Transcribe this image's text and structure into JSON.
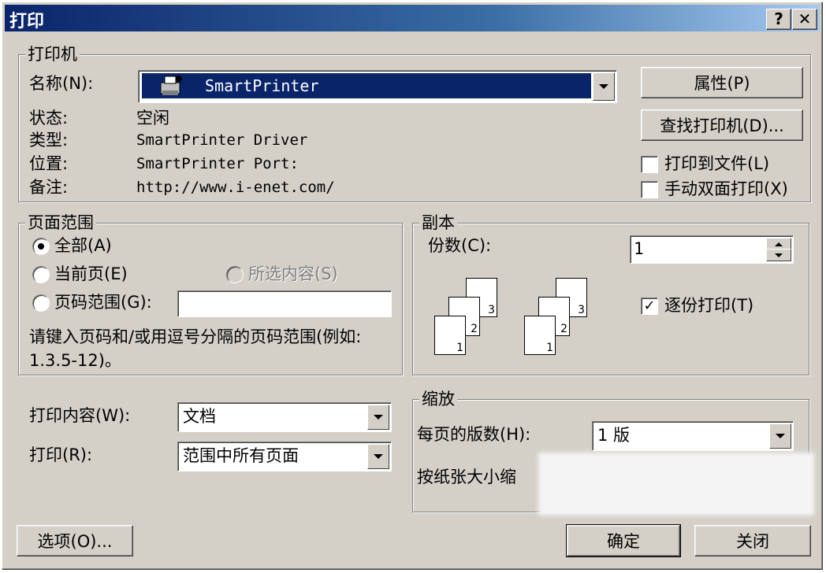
{
  "window": {
    "title": "打印",
    "help_btn": "?",
    "close_btn": "✕"
  },
  "printer": {
    "legend": "打印机",
    "name_label": "名称(N):",
    "name_value": "SmartPrinter",
    "status_label": "状态:",
    "status_value": "空闲",
    "type_label": "类型:",
    "type_value": "SmartPrinter Driver",
    "where_label": "位置:",
    "where_value": "SmartPrinter Port:",
    "comment_label": "备注:",
    "comment_value": "http://www.i-enet.com/",
    "properties_btn": "属性(P)",
    "find_btn": "查找打印机(D)...",
    "print_to_file": "打印到文件(L)",
    "manual_duplex": "手动双面打印(X)"
  },
  "range": {
    "legend": "页面范围",
    "all": "全部(A)",
    "current": "当前页(E)",
    "selection": "所选内容(S)",
    "pages": "页码范围(G):",
    "pages_value": "",
    "hint": "请键入页码和/或用逗号分隔的页码范围(例如: 1.3.5-12)。"
  },
  "copies": {
    "legend": "副本",
    "count_label": "份数(C):",
    "count_value": "1",
    "collate": "逐份打印(T)",
    "collate_checked": true,
    "page_nums": [
      "1",
      "2",
      "3"
    ]
  },
  "content": {
    "what_label": "打印内容(W):",
    "what_value": "文档",
    "print_label": "打印(R):",
    "print_value": "范围中所有页面"
  },
  "zoom": {
    "legend": "缩放",
    "per_sheet_label": "每页的版数(H):",
    "per_sheet_value": "1 版",
    "scale_label": "按纸张大小缩"
  },
  "footer": {
    "options_btn": "选项(O)...",
    "ok_btn": "确定",
    "close_btn": "关闭"
  }
}
